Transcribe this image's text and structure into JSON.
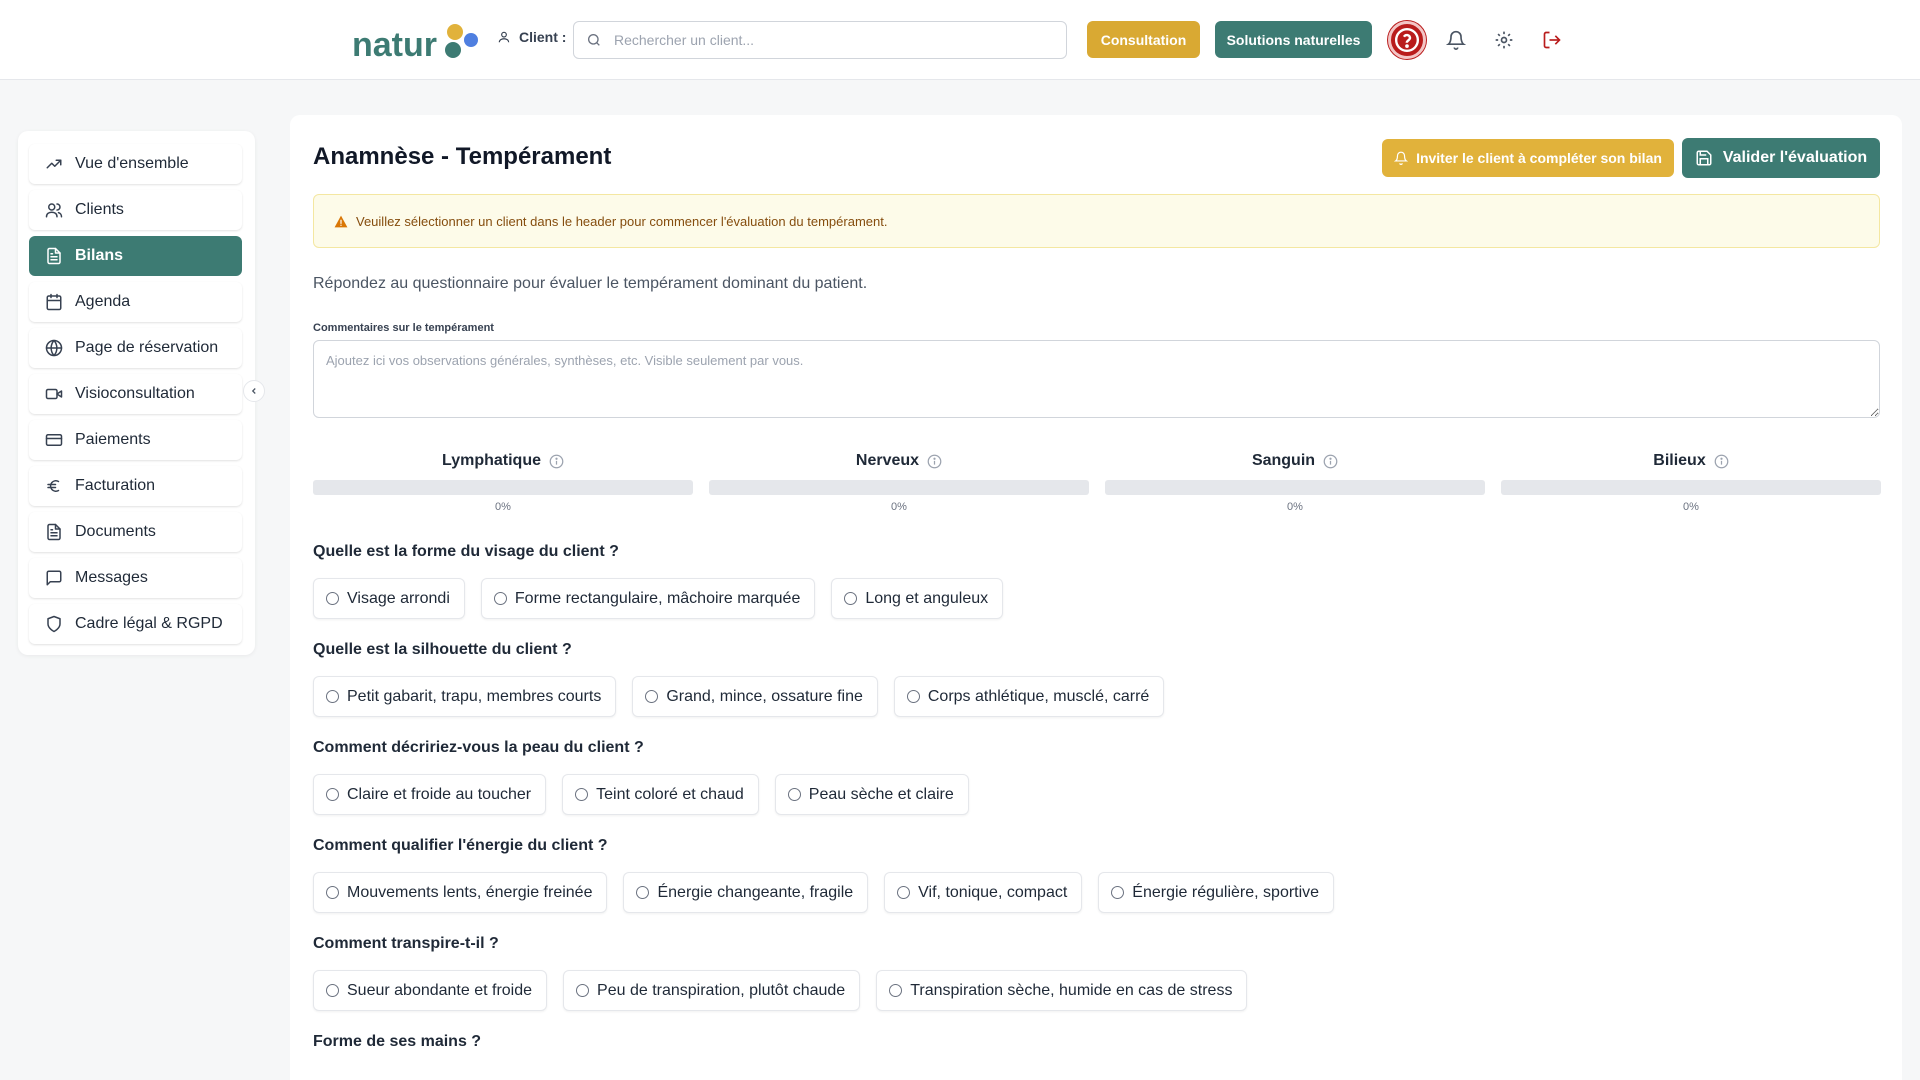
{
  "header": {
    "logo_text": "natur",
    "client_label": "Client :",
    "search_placeholder": "Rechercher un client...",
    "consultation_label": "Consultation",
    "solutions_label": "Solutions naturelles"
  },
  "sidebar": {
    "items": [
      {
        "label": "Vue d'ensemble",
        "icon": "trending-up-icon"
      },
      {
        "label": "Clients",
        "icon": "users-icon"
      },
      {
        "label": "Bilans",
        "icon": "document-icon",
        "active": true
      },
      {
        "label": "Agenda",
        "icon": "calendar-icon"
      },
      {
        "label": "Page de réservation",
        "icon": "globe-icon"
      },
      {
        "label": "Visioconsultation",
        "icon": "video-icon"
      },
      {
        "label": "Paiements",
        "icon": "credit-card-icon"
      },
      {
        "label": "Facturation",
        "icon": "euro-icon"
      },
      {
        "label": "Documents",
        "icon": "document-icon"
      },
      {
        "label": "Messages",
        "icon": "message-icon"
      },
      {
        "label": "Cadre légal & RGPD",
        "icon": "shield-icon"
      }
    ]
  },
  "main": {
    "title": "Anamnèse - Tempérament",
    "invite_label": "Inviter le client à compléter son bilan",
    "validate_label": "Valider l'évaluation",
    "alert": "Veuillez sélectionner un client dans le header pour commencer l'évaluation du tempérament.",
    "intro": "Répondez au questionnaire pour évaluer le tempérament dominant du patient.",
    "comment_label": "Commentaires sur le tempérament",
    "comment_placeholder": "Ajoutez ici vos observations générales, synthèses, etc. Visible seulement par vous.",
    "temperaments": [
      {
        "name": "Lymphatique",
        "percent_label": "0%",
        "value": 0
      },
      {
        "name": "Nerveux",
        "percent_label": "0%",
        "value": 0
      },
      {
        "name": "Sanguin",
        "percent_label": "0%",
        "value": 0
      },
      {
        "name": "Bilieux",
        "percent_label": "0%",
        "value": 0
      }
    ],
    "questions": [
      {
        "label": "Quelle est la forme du visage du client ?",
        "options": [
          "Visage arrondi",
          "Forme rectangulaire, mâchoire marquée",
          "Long et anguleux"
        ]
      },
      {
        "label": "Quelle est la silhouette du client ?",
        "options": [
          "Petit gabarit, trapu, membres courts",
          "Grand, mince, ossature fine",
          "Corps athlétique, musclé, carré"
        ]
      },
      {
        "label": "Comment décririez-vous la peau du client ?",
        "options": [
          "Claire et froide au toucher",
          "Teint coloré et chaud",
          "Peau sèche et claire"
        ]
      },
      {
        "label": "Comment qualifier l'énergie du client ?",
        "options": [
          "Mouvements lents, énergie freinée",
          "Énergie changeante, fragile",
          "Vif, tonique, compact",
          "Énergie régulière, sportive"
        ]
      },
      {
        "label": "Comment transpire-t-il ?",
        "options": [
          "Sueur abondante et froide",
          "Peu de transpiration, plutôt chaude",
          "Transpiration sèche, humide en cas de stress"
        ]
      },
      {
        "label": "Forme de ses mains ?",
        "options": []
      }
    ]
  },
  "colors": {
    "primary": "#3d7b73",
    "accent": "#d9a933",
    "help": "#b91c1c"
  }
}
